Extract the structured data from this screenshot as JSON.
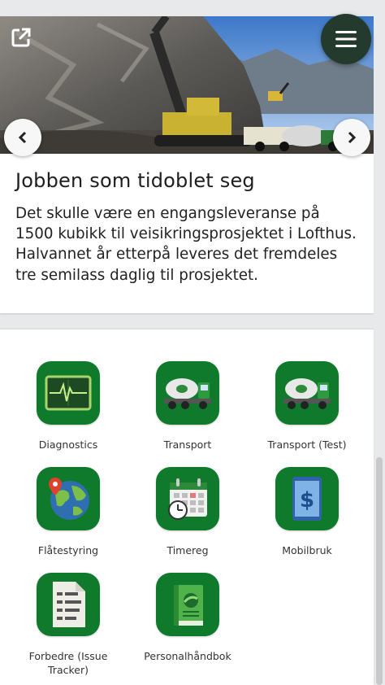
{
  "article": {
    "title": "Jobben som tidoblet seg",
    "body": "Det skulle være en engangsleveranse på 1500 kubikk til veisikringsprosjektet i Lofthus. Halvannet år etterpå leveres det fremdeles tre semilass daglig til prosjektet."
  },
  "apps": [
    {
      "label": "Diagnostics",
      "icon": "diagnostics-monitor-icon"
    },
    {
      "label": "Transport",
      "icon": "concrete-truck-icon"
    },
    {
      "label": "Transport (Test)",
      "icon": "concrete-truck-icon"
    },
    {
      "label": "Flåtestyring",
      "icon": "globe-location-icon"
    },
    {
      "label": "Timereg",
      "icon": "calendar-clock-icon"
    },
    {
      "label": "Mobilbruk",
      "icon": "phone-dollar-icon"
    },
    {
      "label": "Forbedre (Issue Tracker)",
      "icon": "document-checklist-icon"
    },
    {
      "label": "Personalhåndbok",
      "icon": "handbook-icon"
    }
  ],
  "colors": {
    "app_green": "#0f7a2c",
    "menu_button": "#233a2c"
  }
}
